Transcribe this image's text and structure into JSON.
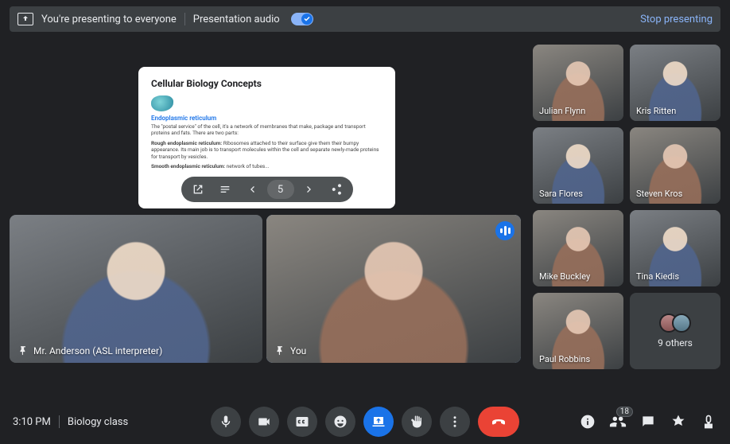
{
  "banner": {
    "presenting_text": "You're presenting to everyone",
    "audio_label": "Presentation audio",
    "stop_label": "Stop presenting"
  },
  "presentation": {
    "title": "Cellular Biology Concepts",
    "subhead": "Endoplasmic reticulum",
    "p1": "The \"postal service\" of the cell, it's a network of membranes that make, package and transport proteins and fats. There are two parts:",
    "p2_label": "Rough endoplasmic reticulum:",
    "p2_text": " Ribosomes attached to their surface give them their bumpy appearance. Its main job is to transport molecules within the cell and separate newly-made proteins for transport by vesicles.",
    "p3_label": "Smooth endoplasmic reticulum:",
    "p3_text": " network of tubes...",
    "slide_number": "5"
  },
  "tiles": {
    "anderson": "Mr. Anderson (ASL interpreter)",
    "you": "You"
  },
  "grid": [
    "Julian Flynn",
    "Kris Ritten",
    "Sara Flores",
    "Steven Kros",
    "Mike Buckley",
    "Tina Kiedis",
    "Paul Robbins"
  ],
  "others": {
    "label": "9 others"
  },
  "bottom": {
    "time": "3:10 PM",
    "meeting_name": "Biology class",
    "participant_count": "18"
  }
}
